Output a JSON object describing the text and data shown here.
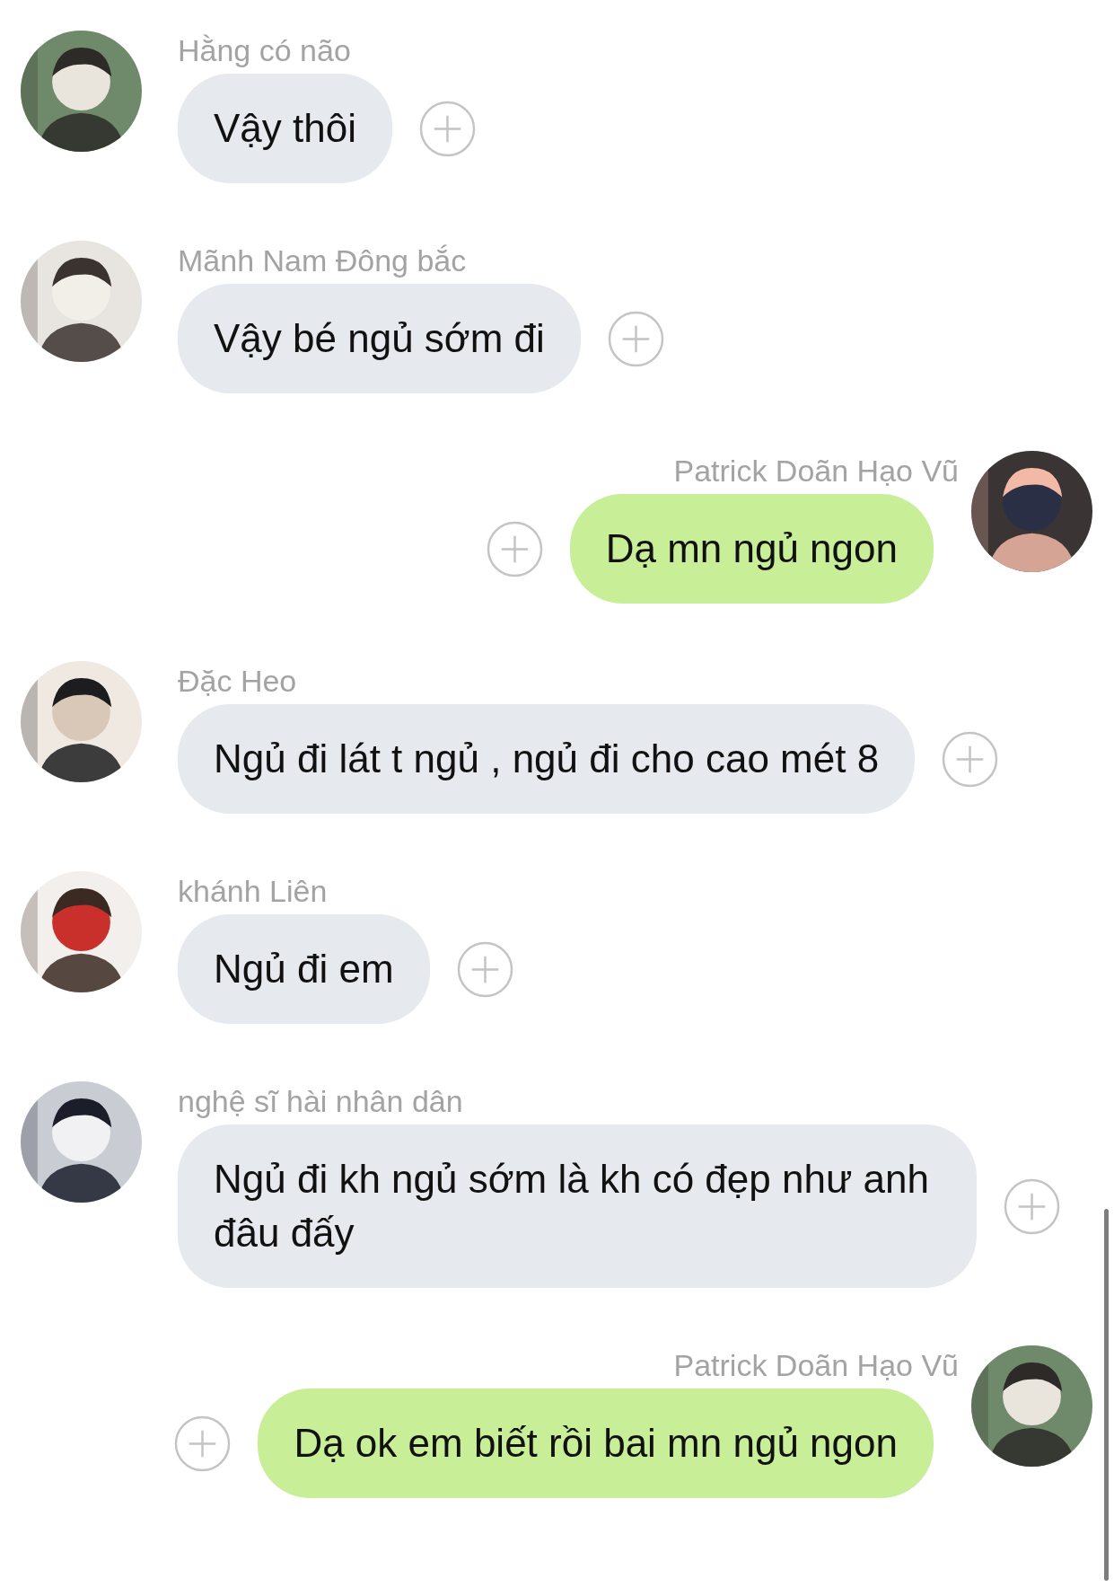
{
  "messages": [
    {
      "kind": "incoming",
      "sender": "Hằng có não",
      "text": "Vậy thôi"
    },
    {
      "kind": "incoming",
      "sender": "Mãnh Nam Đông bắc",
      "text": "Vậy bé ngủ sớm đi"
    },
    {
      "kind": "outgoing",
      "sender": "Patrick Doãn Hạo Vũ",
      "text": "Dạ mn ngủ ngon"
    },
    {
      "kind": "incoming",
      "sender": "Đặc Heo",
      "text": "Ngủ đi lát t ngủ , ngủ đi cho cao mét 8"
    },
    {
      "kind": "incoming",
      "sender": "khánh Liên",
      "text": "Ngủ đi em"
    },
    {
      "kind": "incoming",
      "sender": "nghệ sĩ hài nhân dân",
      "text": "Ngủ đi kh ngủ sớm là kh có đẹp như anh đâu đấy"
    },
    {
      "kind": "outgoing",
      "sender": "Patrick Doãn Hạo Vũ",
      "text": "Dạ ok em biết rồi bai mn ngủ ngon"
    }
  ]
}
